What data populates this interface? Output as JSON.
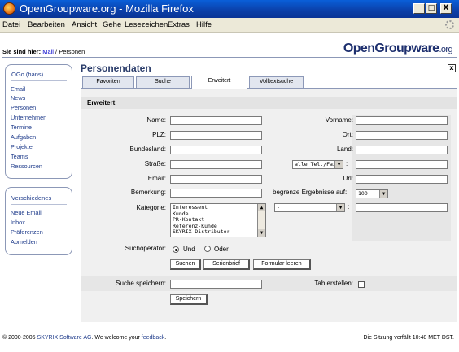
{
  "window": {
    "title": "OpenGroupware.org - Mozilla Firefox",
    "min": "_",
    "max": "□",
    "close": "X"
  },
  "menu": [
    "Datei",
    "Bearbeiten",
    "Ansicht",
    "Gehe",
    "Lesezeichen",
    "Extras",
    "Hilfe"
  ],
  "location": {
    "prefix": "Sie sind hier:",
    "crumb1": "Mail",
    "sep": " / ",
    "crumb2": "Personen"
  },
  "logo": {
    "main": "OpenGroupware",
    "suffix": ".org"
  },
  "sidebar": {
    "user": "OGo (hans)",
    "nav": [
      "Email",
      "News",
      "Personen",
      "Unternehmen",
      "Termine",
      "Aufgaben",
      "Projekte",
      "Teams",
      "Ressourcen"
    ],
    "misc_title": "Verschiedenes",
    "misc": [
      "Neue Email",
      "Inbox",
      "Präferenzen",
      "Abmelden"
    ]
  },
  "page": {
    "title": "Personendaten",
    "close": "x"
  },
  "tabs": [
    "Favoriten",
    "Suche",
    "Erweitert",
    "Volltextsuche"
  ],
  "section": "Erweitert",
  "form": {
    "name": "Name:",
    "vorname": "Vorname:",
    "plz": "PLZ:",
    "ort": "Ort:",
    "bundesland": "Bundesland:",
    "land": "Land:",
    "strasse": "Straße:",
    "tel_select": "alle Tel./Fax",
    "tel_colon": ":",
    "email": "Email:",
    "url": "Url:",
    "bemerkung": "Bemerkung:",
    "limit": "begrenze Ergebnisse auf:",
    "limit_value": "100",
    "kategorie": "Kategorie:",
    "kategorie_options": [
      "Interessent",
      "Kunde",
      "PR-Kontakt",
      "Referenz-Kunde",
      "SKYRIX Distributor"
    ],
    "extra_select": "-",
    "extra_colon": ":",
    "operator": "Suchoperator:",
    "und": "Und",
    "oder": "Oder",
    "suchen": "Suchen",
    "serienbrief": "Serienbrief",
    "leeren": "Formular leeren",
    "save_search": "Suche speichern:",
    "tab_create": "Tab erstellen:",
    "speichern": "Speichern"
  },
  "footer": {
    "pre": "© 2000-2005 ",
    "company": "SKYRIX Software AG",
    "mid": ". We welcome your ",
    "feedback": "feedback",
    "end": ".",
    "session": "Die Sitzung verfällt 10:48 MET DST."
  },
  "colors": {
    "titlebar": "#0a3fa8",
    "link": "#1d3a8a",
    "panel": "#f0f0f0"
  }
}
